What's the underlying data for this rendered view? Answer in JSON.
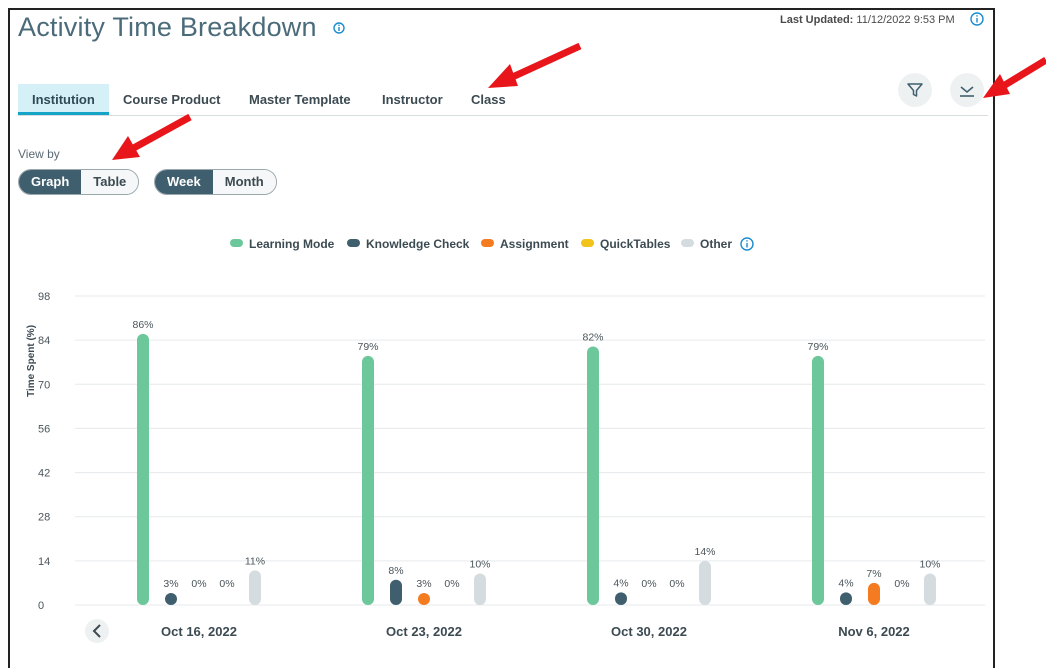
{
  "title": "Activity Time Breakdown",
  "last_updated": {
    "label": "Last Updated:",
    "value": "11/12/2022 9:53 PM"
  },
  "tabs": [
    {
      "label": "Institution",
      "active": true
    },
    {
      "label": "Course Product",
      "active": false
    },
    {
      "label": "Master Template",
      "active": false
    },
    {
      "label": "Instructor",
      "active": false
    },
    {
      "label": "Class",
      "active": false
    }
  ],
  "toolbar": {
    "filter_icon": "filter-icon",
    "download_icon": "download-icon"
  },
  "view_by": {
    "label": "View by",
    "mode_options": [
      "Graph",
      "Table"
    ],
    "mode_selected": "Graph",
    "period_options": [
      "Week",
      "Month"
    ],
    "period_selected": "Week"
  },
  "colors": {
    "Learning Mode": "#6cc79b",
    "Knowledge Check": "#3f5f6e",
    "Assignment": "#f47b20",
    "QuickTables": "#f2c31a",
    "Other": "#d5dce0"
  },
  "chart_data": {
    "type": "bar",
    "ylabel": "Time Spent (%)",
    "ylim": [
      0,
      98
    ],
    "yticks": [
      0,
      14,
      28,
      42,
      56,
      70,
      84,
      98
    ],
    "grid": true,
    "legend_position": "top-center",
    "categories": [
      "Oct 16, 2022",
      "Oct 23, 2022",
      "Oct 30, 2022",
      "Nov 6, 2022"
    ],
    "series": [
      {
        "name": "Learning Mode",
        "values": [
          86,
          79,
          82,
          79
        ]
      },
      {
        "name": "Knowledge Check",
        "values": [
          3,
          8,
          4,
          4
        ]
      },
      {
        "name": "Assignment",
        "values": [
          0,
          3,
          0,
          7
        ]
      },
      {
        "name": "QuickTables",
        "values": [
          0,
          0,
          0,
          0
        ]
      },
      {
        "name": "Other",
        "values": [
          11,
          10,
          14,
          10
        ]
      }
    ],
    "value_suffix": "%"
  }
}
